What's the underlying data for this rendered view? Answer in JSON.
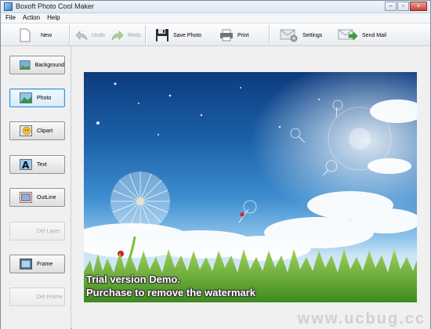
{
  "window": {
    "title": "Boxoft Photo Cool Maker",
    "buttons": [
      "–",
      "▫",
      "×"
    ]
  },
  "menu": [
    "File",
    "Action",
    "Help"
  ],
  "toolbar": {
    "new": "New",
    "undo": "Undo",
    "redo": "Redo",
    "save_photo": "Save Photo",
    "print": "Print",
    "settings": "Settings",
    "send_mail": "Send Mail"
  },
  "sidebar": {
    "background": "Background",
    "photo": "Photo",
    "clipart": "Clipart",
    "text": "Text",
    "outline": "OutLine",
    "del_layer": "Del Layer",
    "frame": "Frame",
    "del_frame": "Del Frame"
  },
  "canvas": {
    "watermark_line1": "Trial version Demo.",
    "watermark_line2": "Purchase to remove the watermark"
  },
  "site_watermark": "www.ucbug.cc",
  "colors": {
    "accent": "#3b8fd0",
    "sky_top": "#0d3b7e",
    "grass": "#5aa02c"
  }
}
